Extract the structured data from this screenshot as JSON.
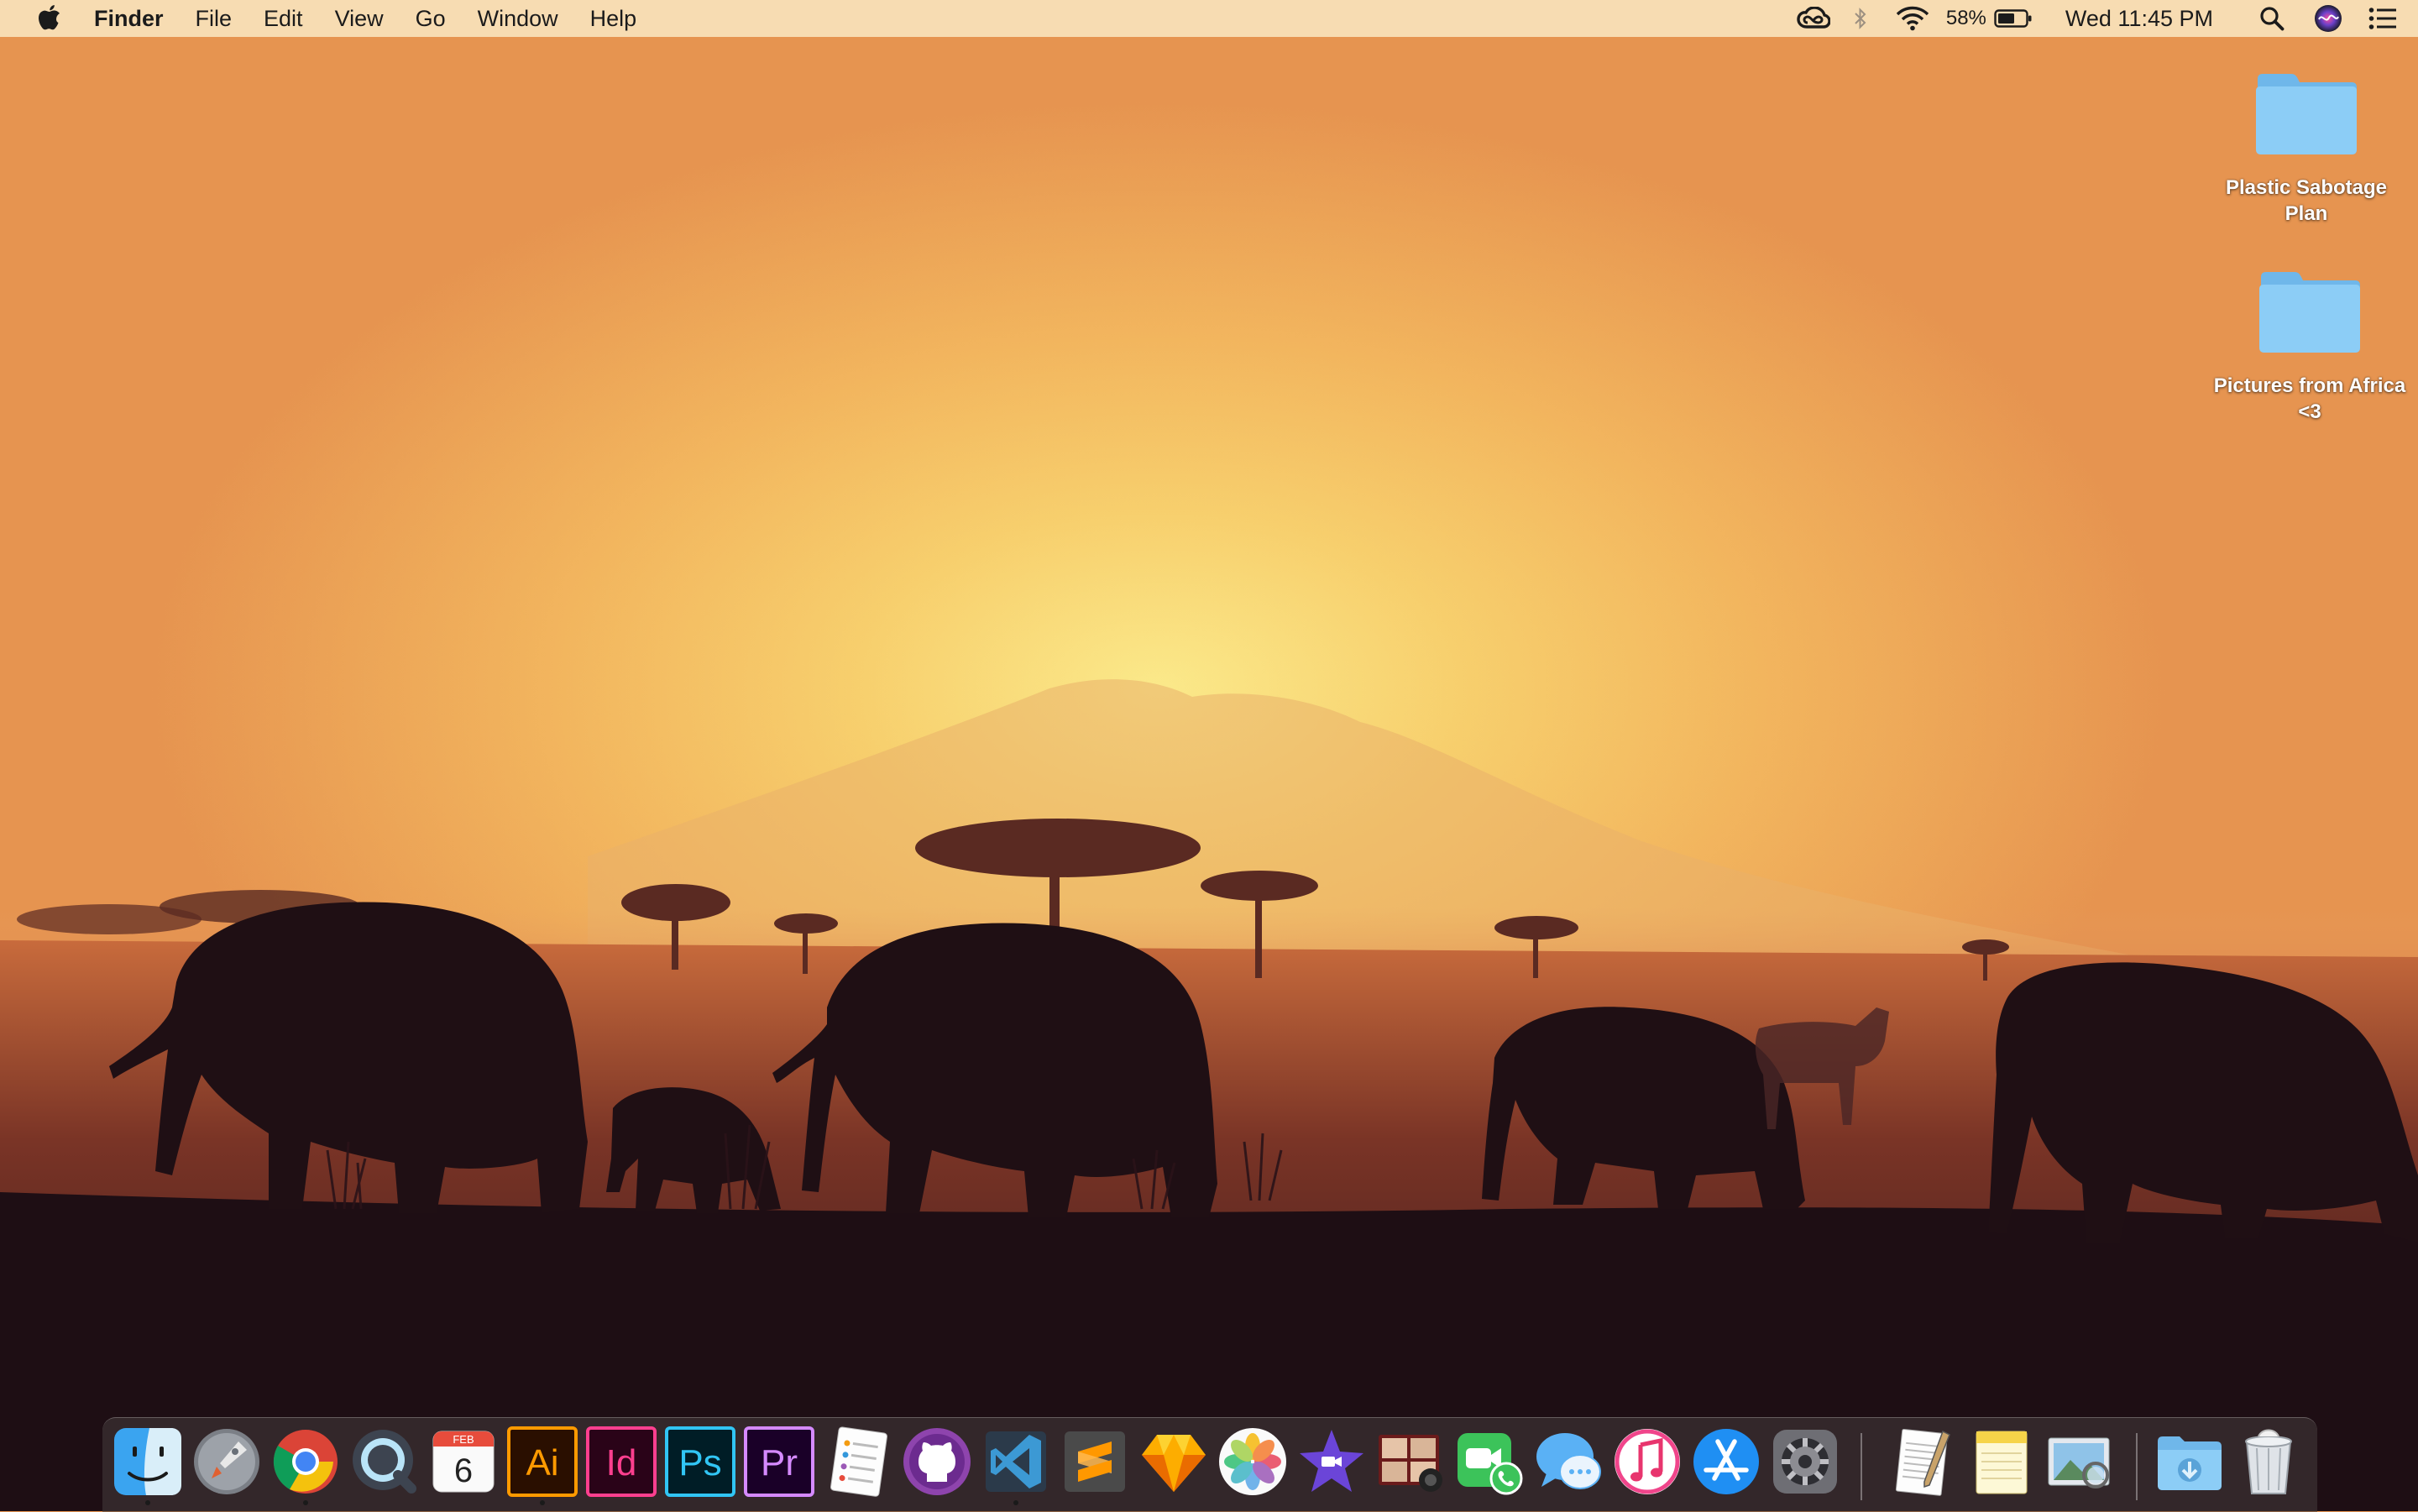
{
  "menubar": {
    "app_name": "Finder",
    "menus": [
      "File",
      "Edit",
      "View",
      "Go",
      "Window",
      "Help"
    ],
    "battery_percent": "58%",
    "clock": "Wed 11:45 PM"
  },
  "desktop": {
    "icons": [
      {
        "label": "Plastic Sabotage Plan"
      },
      {
        "label": "Pictures from Africa <3"
      }
    ]
  },
  "dock": {
    "calendar_month": "FEB",
    "calendar_day": "6",
    "illustrator_label": "Ai",
    "indesign_label": "Id",
    "photoshop_label": "Ps",
    "premiere_label": "Pr"
  },
  "colors": {
    "menubar_bg": "#f7e2ba",
    "folder_blue": "#7cc3f2",
    "dock_bg": "#463c3c"
  }
}
